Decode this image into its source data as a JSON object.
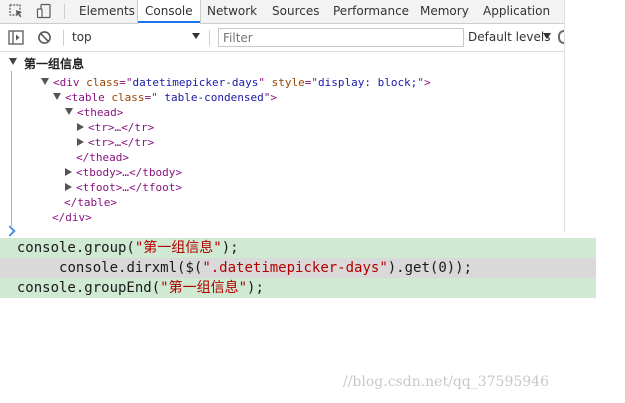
{
  "tabs": [
    "Elements",
    "Console",
    "Network",
    "Sources",
    "Performance",
    "Memory",
    "Application"
  ],
  "toolbar": {
    "context": "top",
    "filter_placeholder": "Filter",
    "levels": "Default levels"
  },
  "group": {
    "label": "第一组信息"
  },
  "tree": [
    {
      "open": "<div",
      "attrs": [
        {
          "n": "class",
          "v": "datetimepicker-days"
        },
        {
          "n": "style",
          "v": "display: block;"
        }
      ],
      "close": ">"
    },
    {
      "open": "<table",
      "attrs": [
        {
          "n": "class",
          "v": " table-condensed"
        }
      ],
      "close": ">"
    },
    {
      "open": "<thead>"
    },
    {
      "open": "<tr>",
      "ellipsis": "…",
      "end": "</tr>"
    },
    {
      "open": "<tr>",
      "ellipsis": "…",
      "end": "</tr>"
    },
    {
      "open": "</thead>"
    },
    {
      "open": "<tbody>",
      "ellipsis": "…",
      "end": "</tbody>"
    },
    {
      "open": "<tfoot>",
      "ellipsis": "…",
      "end": "</tfoot>"
    },
    {
      "open": "</table>"
    },
    {
      "open": "</div>"
    }
  ],
  "code": {
    "line1": {
      "prefix": "console.group(",
      "str": "\"第一组信息\"",
      "suffix": ");"
    },
    "line2": {
      "prefix": "console.dirxml($(",
      "str": "\".datetimepicker-days\"",
      "suffix": ").get(0));"
    },
    "line3": {
      "prefix": "console.groupEnd(",
      "str": "\"第一组信息\"",
      "suffix": ");"
    }
  },
  "watermark": "//blog.csdn.net/qq_37595946",
  "colors": {
    "tag": "#881280",
    "attr_name": "#994500",
    "attr_value": "#1a1aa6",
    "code_bg": "#cfe9d3",
    "code_highlight": "#d9d9d9",
    "string": "#b30000",
    "active_tab": "#1a73e8"
  },
  "icons": [
    "inspect-element-icon",
    "device-toggle-icon",
    "console-sidebar-icon",
    "clear-console-icon",
    "dropdown-arrow-icon",
    "settings-gear-icon",
    "prompt-caret-icon"
  ]
}
